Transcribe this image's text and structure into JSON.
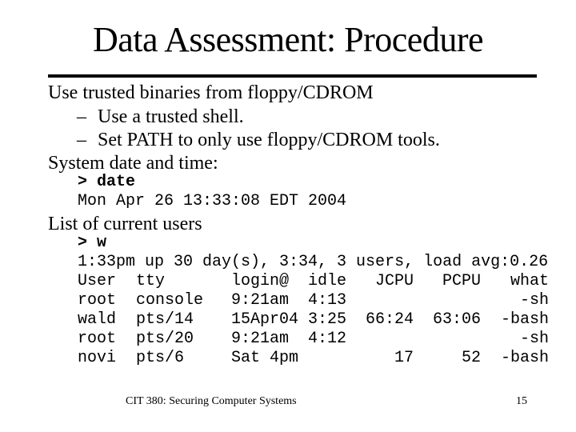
{
  "title": "Data Assessment: Procedure",
  "bullets": [
    {
      "text": "Use trusted binaries from floppy/CDROM"
    },
    {
      "dash": "–",
      "text": "Use a trusted shell."
    },
    {
      "dash": "–",
      "text": "Set PATH to only use floppy/CDROM tools."
    },
    {
      "text": "System date and time:"
    }
  ],
  "date_block": {
    "prompt": "> date",
    "output": "Mon Apr 26 13:33:08 EDT 2004"
  },
  "users_heading": "List of current users",
  "w_block": {
    "prompt": "> w",
    "uptime_line": "1:33pm up 30 day(s), 3:34, 3 users, load avg:0.26",
    "table": {
      "columns": [
        "User",
        "tty",
        "login@",
        "idle",
        "JCPU",
        "PCPU",
        "what"
      ],
      "rows": [
        [
          "root",
          "console",
          "9:21am",
          "4:13",
          "",
          "",
          "-sh"
        ],
        [
          "wald",
          "pts/14",
          "15Apr04",
          "3:25",
          "66:24",
          "63:06",
          "-bash"
        ],
        [
          "root",
          "pts/20",
          "9:21am",
          "4:12",
          "",
          "",
          "-sh"
        ],
        [
          "novi",
          "pts/6",
          "Sat 4pm",
          "",
          "17",
          "52",
          "-bash"
        ]
      ]
    }
  },
  "footer": {
    "course": "CIT 380: Securing Computer Systems",
    "page_number": "15"
  }
}
